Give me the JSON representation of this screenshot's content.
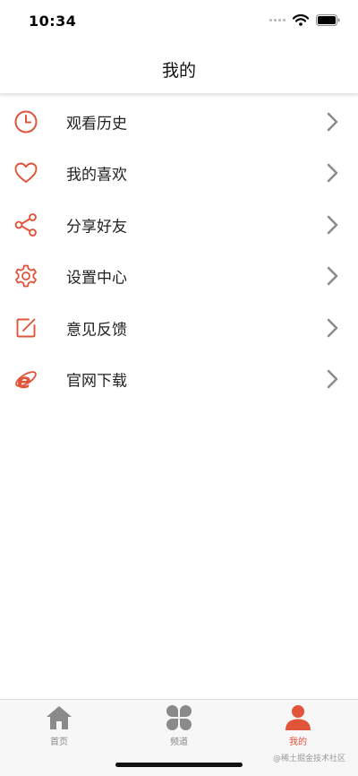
{
  "status": {
    "time": "10:34"
  },
  "nav": {
    "title": "我的"
  },
  "menu": [
    {
      "label": "观看历史",
      "icon": "clock-icon"
    },
    {
      "label": "我的喜欢",
      "icon": "heart-icon"
    },
    {
      "label": "分享好友",
      "icon": "share-icon"
    },
    {
      "label": "设置中心",
      "icon": "gear-icon"
    },
    {
      "label": "意见反馈",
      "icon": "edit-icon"
    },
    {
      "label": "官网下载",
      "icon": "ie-browser-icon"
    }
  ],
  "tabs": [
    {
      "label": "首页",
      "icon": "home-icon",
      "active": false
    },
    {
      "label": "频道",
      "icon": "grid-icon",
      "active": false
    },
    {
      "label": "我的",
      "icon": "user-icon",
      "active": true
    }
  ],
  "colors": {
    "accent": "#e0543a",
    "inactive": "#8a8a8a",
    "chevron": "#8c8c8c"
  },
  "watermark": "@稀土掘金技术社区"
}
